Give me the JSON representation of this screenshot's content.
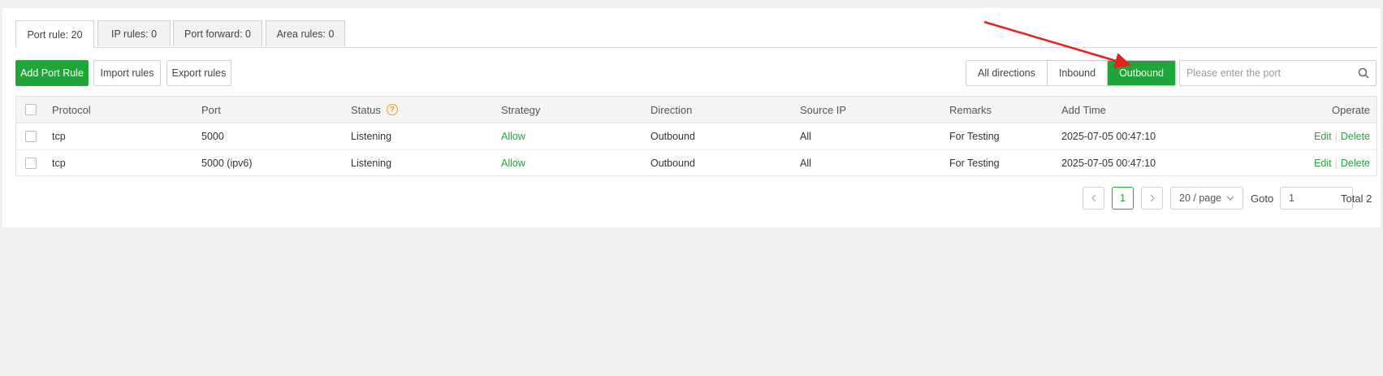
{
  "tabs": [
    {
      "label": "Port rule: 20"
    },
    {
      "label": "IP rules: 0"
    },
    {
      "label": "Port forward: 0"
    },
    {
      "label": "Area rules: 0"
    }
  ],
  "toolbar": {
    "add_label": "Add Port Rule",
    "import_label": "Import rules",
    "export_label": "Export rules"
  },
  "direction_filter": {
    "options": [
      "All directions",
      "Inbound",
      "Outbound"
    ],
    "selected": "Outbound"
  },
  "search": {
    "placeholder": "Please enter the port",
    "value": ""
  },
  "table": {
    "columns": [
      "Protocol",
      "Port",
      "Status",
      "Strategy",
      "Direction",
      "Source IP",
      "Remarks",
      "Add Time",
      "Operate"
    ],
    "rows": [
      {
        "protocol": "tcp",
        "port": "5000",
        "status": "Listening",
        "strategy": "Allow",
        "direction": "Outbound",
        "source_ip": "All",
        "remarks": "For Testing",
        "add_time": "2025-07-05 00:47:10",
        "edit": "Edit",
        "delete": "Delete"
      },
      {
        "protocol": "tcp",
        "port": "5000 (ipv6)",
        "status": "Listening",
        "strategy": "Allow",
        "direction": "Outbound",
        "source_ip": "All",
        "remarks": "For Testing",
        "add_time": "2025-07-05 00:47:10",
        "edit": "Edit",
        "delete": "Delete"
      }
    ],
    "status_help_glyph": "?"
  },
  "pagination": {
    "current_page": "1",
    "page_size": "20 / page",
    "goto_label": "Goto",
    "goto_value": "1",
    "total": "Total 2"
  },
  "colors": {
    "accent": "#20a53a",
    "annotation_arrow": "#e8231f",
    "help_icon": "#f0a020"
  },
  "icons": [
    "search-icon",
    "help-icon",
    "chevron-left-icon",
    "chevron-right-icon",
    "chevron-down-icon",
    "annotation-arrow"
  ]
}
